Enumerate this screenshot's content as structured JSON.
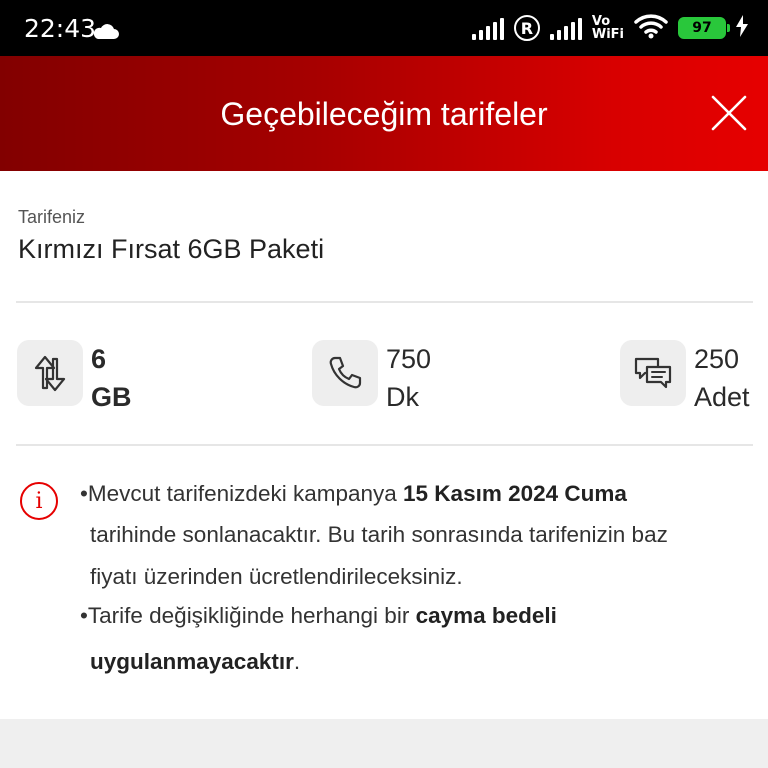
{
  "status_bar": {
    "time": "22:43",
    "vowifi_top": "Vo",
    "vowifi_bottom": "WiFi",
    "r_label": "R",
    "battery": "97"
  },
  "header": {
    "title": "Geçebileceğim tarifeler"
  },
  "current_tariff": {
    "label": "Tarifeniz",
    "name": "Kırmızı Fırsat 6GB Paketi"
  },
  "allowances": {
    "data": {
      "amount": "6",
      "unit": "GB"
    },
    "voice": {
      "amount": "750",
      "unit": "Dk"
    },
    "sms": {
      "amount": "250",
      "unit": "Adet"
    }
  },
  "info": {
    "icon_glyph": "i",
    "line1_pre": "•Mevcut tarifenizdeki kampanya ",
    "line1_bold": "15 Kasım 2024 Cuma",
    "line2": "tarihinde sonlanacaktır. Bu tarih sonrasında tarifenizin baz",
    "line3": "fiyatı üzerinden ücretlendirileceksiniz.",
    "line4_pre": "•Tarife değişikliğinde herhangi bir ",
    "line4_bold": "cayma bedeli",
    "line5_bold": "uygulanmayacaktır",
    "line5_post": "."
  },
  "colors": {
    "brand_red": "#e60000",
    "header_dark": "#820000",
    "battery_green": "#29c73b"
  },
  "icons": [
    "cloud-icon",
    "signal-icon",
    "r-icon",
    "wifi-icon",
    "battery-icon",
    "charging-icon",
    "close-icon",
    "data-arrows-icon",
    "phone-icon",
    "sms-icon",
    "info-icon"
  ]
}
